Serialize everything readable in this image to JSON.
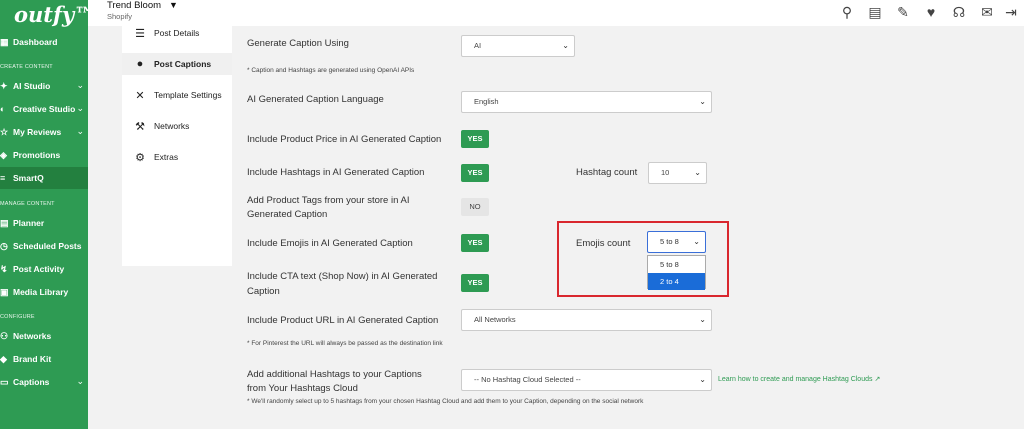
{
  "brand": {
    "logo": "outfy™"
  },
  "sidebar": {
    "sections": [
      "CREATE CONTENT",
      "MANAGE CONTENT",
      "CONFIGURE"
    ],
    "items": [
      {
        "label": "Dashboard",
        "icon": "grid-icon"
      },
      {
        "label": "AI Studio",
        "icon": "sparkle-icon"
      },
      {
        "label": "Creative Studio",
        "icon": "palette-icon"
      },
      {
        "label": "My Reviews",
        "icon": "star-icon"
      },
      {
        "label": "Promotions",
        "icon": "megaphone-icon"
      },
      {
        "label": "SmartQ",
        "icon": "queue-icon"
      },
      {
        "label": "Planner",
        "icon": "calendar-icon"
      },
      {
        "label": "Scheduled Posts",
        "icon": "clock-icon"
      },
      {
        "label": "Post Activity",
        "icon": "activity-icon"
      },
      {
        "label": "Media Library",
        "icon": "image-icon"
      },
      {
        "label": "Networks",
        "icon": "network-icon"
      },
      {
        "label": "Brand Kit",
        "icon": "brand-icon"
      },
      {
        "label": "Captions",
        "icon": "caption-icon"
      }
    ]
  },
  "header": {
    "store_name": "Trend Bloom",
    "store_platform": "Shopify"
  },
  "subnav": {
    "items": [
      {
        "label": "Post Details",
        "icon": "sliders-icon"
      },
      {
        "label": "Post Captions",
        "icon": "ai-head-icon"
      },
      {
        "label": "Template Settings",
        "icon": "tools-icon"
      },
      {
        "label": "Networks",
        "icon": "wrench-icon"
      },
      {
        "label": "Extras",
        "icon": "gear-icon"
      }
    ]
  },
  "form": {
    "generate_using": {
      "label": "Generate Caption Using",
      "value": "AI",
      "note": "* Caption and Hashtags are generated using OpenAI APIs"
    },
    "language": {
      "label": "AI Generated Caption Language",
      "value": "English"
    },
    "include_price": {
      "label": "Include Product Price in AI Generated Caption",
      "value": "YES"
    },
    "include_hashtags": {
      "label": "Include Hashtags in AI Generated Caption",
      "value": "YES"
    },
    "hashtag_count": {
      "label": "Hashtag count",
      "value": "10"
    },
    "product_tags": {
      "label_line1": "Add Product Tags from your store in AI",
      "label_line2": "Generated Caption",
      "value": "NO"
    },
    "include_emojis": {
      "label": "Include Emojis in AI Generated Caption",
      "value": "YES"
    },
    "emojis_count": {
      "label": "Emojis count",
      "value": "5 to 8",
      "options": [
        "5 to 8",
        "2 to 4"
      ]
    },
    "include_cta": {
      "label_line1": "Include CTA text (Shop Now) in AI Generated",
      "label_line2": "Caption",
      "value": "YES"
    },
    "include_url": {
      "label": "Include Product URL in AI Generated Caption",
      "value": "All Networks",
      "note": "* For Pinterest the URL will always be passed as the destination link"
    },
    "hashtag_cloud": {
      "label_line1": "Add additional Hashtags to your Captions",
      "label_line2": "from Your Hashtags Cloud",
      "value": "-- No Hashtag Cloud Selected --",
      "link": "Learn how to create and manage Hashtag Clouds",
      "note": "* We'll randomly select up to 5 hashtags from your chosen Hashtag Cloud and add them to your Caption, depending on the social network"
    }
  },
  "colors": {
    "brand_green": "#2e9b53",
    "highlight_red": "#d9272e",
    "selected_blue": "#1a6cd8"
  }
}
